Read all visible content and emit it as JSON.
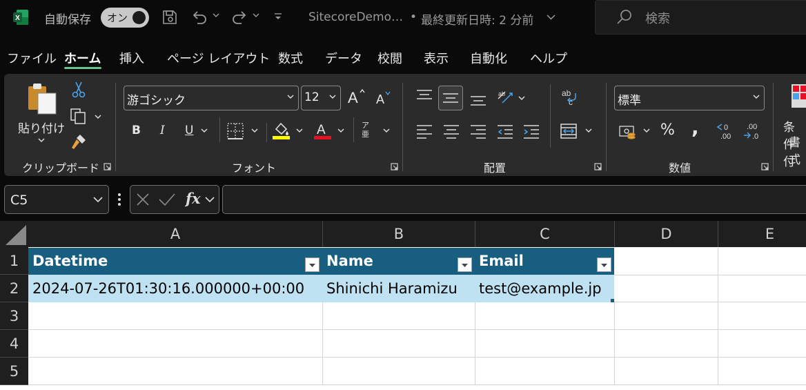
{
  "titlebar": {
    "autosave_label": "自動保存",
    "autosave_toggle": "オン",
    "doc_title": "SitecoreDemo…",
    "dot": "•",
    "last_modified": "最終更新日時: 2 分前",
    "search_placeholder": "検索"
  },
  "menu": {
    "tabs": [
      "ファイル",
      "ホーム",
      "挿入",
      "ページ レイアウト",
      "数式",
      "データ",
      "校閲",
      "表示",
      "自動化",
      "ヘルプ"
    ],
    "active_index": 1
  },
  "ribbon": {
    "clipboard": {
      "paste_label": "貼り付け",
      "group_label": "クリップボード"
    },
    "font": {
      "font_name": "游ゴシック",
      "font_size": "12",
      "bold": "B",
      "italic": "I",
      "underline": "U",
      "font_color_glyph": "A",
      "phonetic_glyph": "ア亜",
      "group_label": "フォント",
      "highlight_color": "#ffff00",
      "font_color": "#e81123"
    },
    "alignment": {
      "group_label": "配置"
    },
    "number": {
      "format": "標準",
      "percent": "%",
      "comma": ",",
      "group_label": "数値"
    },
    "styles": {
      "conditional_label_line1": "条件付",
      "conditional_label_line2": "書式"
    }
  },
  "formula_bar": {
    "name_box": "C5",
    "fx": "fx",
    "formula_value": ""
  },
  "sheet": {
    "columns": [
      "A",
      "B",
      "C",
      "D",
      "E"
    ],
    "rows": [
      "1",
      "2",
      "3",
      "4",
      "5"
    ],
    "table_headers": [
      "Datetime",
      "Name",
      "Email"
    ],
    "table_row": [
      "2024-07-26T01:30:16.000000+00:00",
      "Shinichi Haramizu",
      "test@example.jp"
    ],
    "header_color": "#175e81",
    "row_color": "#bfe2f3"
  }
}
